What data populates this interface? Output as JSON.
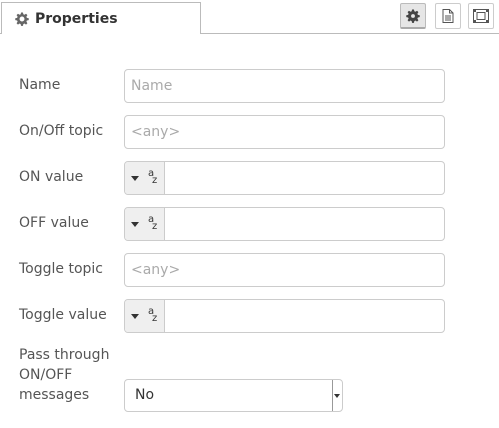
{
  "tab": {
    "title": "Properties",
    "icon": "gear-icon"
  },
  "toolbar": {
    "buttons": [
      {
        "icon": "gear-icon",
        "active": true
      },
      {
        "icon": "document-icon",
        "active": false
      },
      {
        "icon": "frame-icon",
        "active": false
      }
    ]
  },
  "form": {
    "name": {
      "label": "Name",
      "placeholder": "Name",
      "value": ""
    },
    "onoff_topic": {
      "label": "On/Off topic",
      "placeholder": "<any>",
      "value": ""
    },
    "on_value": {
      "label": "ON value",
      "type_icon": "string-type-icon",
      "type_label_top": "a",
      "type_label_bottom": "z",
      "value": ""
    },
    "off_value": {
      "label": "OFF value",
      "type_icon": "string-type-icon",
      "type_label_top": "a",
      "type_label_bottom": "z",
      "value": ""
    },
    "toggle_topic": {
      "label": "Toggle topic",
      "placeholder": "<any>",
      "value": ""
    },
    "toggle_value": {
      "label": "Toggle value",
      "type_icon": "string-type-icon",
      "type_label_top": "a",
      "type_label_bottom": "z",
      "value": ""
    },
    "pass_through": {
      "label_line1": "Pass through",
      "label_line2": "ON/OFF",
      "label_line3": "messages",
      "selected": "No"
    }
  }
}
